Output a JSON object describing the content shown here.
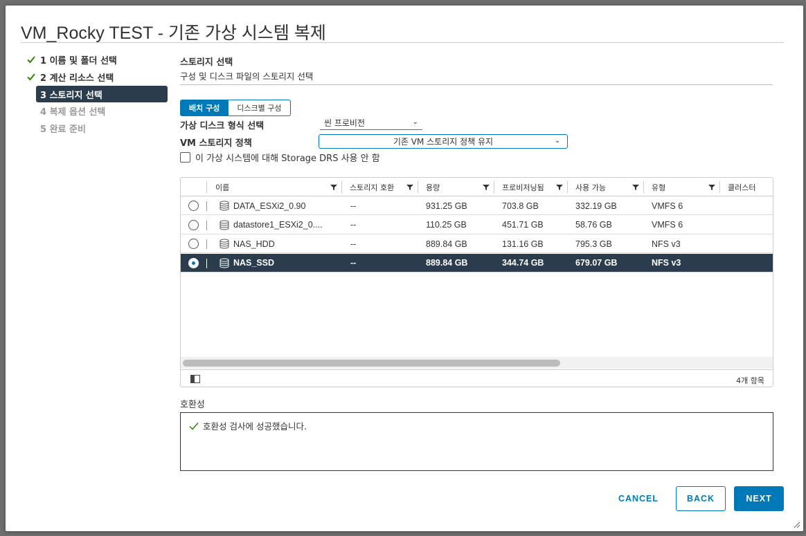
{
  "dialog": {
    "title": "VM_Rocky TEST - 기존 가상 시스템 복제"
  },
  "steps": [
    {
      "label": "1 이름 및 폴더 선택",
      "state": "done"
    },
    {
      "label": "2 계산 리소스 선택",
      "state": "done"
    },
    {
      "label": "3 스토리지 선택",
      "state": "active"
    },
    {
      "label": "4 복제 옵션 선택",
      "state": "pending"
    },
    {
      "label": "5 완료 준비",
      "state": "pending"
    }
  ],
  "section": {
    "title": "스토리지 선택",
    "subtitle": "구성 및 디스크 파일의 스토리지 선택"
  },
  "toggle": {
    "batch": "배치 구성",
    "per_disk": "디스크별 구성"
  },
  "form": {
    "disk_format_label": "가상 디스크 형식 선택",
    "disk_format_value": "씬 프로비전",
    "policy_label": "VM 스토리지 정책",
    "policy_value": "기존 VM 스토리지 정책 유지",
    "drs_label": "이 가상 시스템에 대해 Storage DRS 사용 안 함"
  },
  "grid": {
    "columns": [
      "이름",
      "스토리지 호환",
      "용량",
      "프로비저닝됨",
      "사용 가능",
      "유형",
      "클러스터"
    ],
    "rows": [
      {
        "name": "DATA_ESXi2_0.90",
        "compat": "--",
        "capacity": "931.25 GB",
        "provisioned": "703.8 GB",
        "free": "332.19 GB",
        "type": "VMFS 6",
        "selected": false
      },
      {
        "name": "datastore1_ESXi2_0....",
        "compat": "--",
        "capacity": "110.25 GB",
        "provisioned": "451.71 GB",
        "free": "58.76 GB",
        "type": "VMFS 6",
        "selected": false
      },
      {
        "name": "NAS_HDD",
        "compat": "--",
        "capacity": "889.84 GB",
        "provisioned": "131.16 GB",
        "free": "795.3 GB",
        "type": "NFS v3",
        "selected": false
      },
      {
        "name": "NAS_SSD",
        "compat": "--",
        "capacity": "889.84 GB",
        "provisioned": "344.74 GB",
        "free": "679.07 GB",
        "type": "NFS v3",
        "selected": true
      }
    ],
    "item_count": "4개 항목"
  },
  "compat": {
    "label": "호환성",
    "message": "호환성 검사에 성공했습니다."
  },
  "buttons": {
    "cancel": "CANCEL",
    "back": "BACK",
    "next": "NEXT"
  },
  "colors": {
    "accent": "#0079b8",
    "selected_row": "#2b3d4c",
    "success": "#2f8400"
  }
}
